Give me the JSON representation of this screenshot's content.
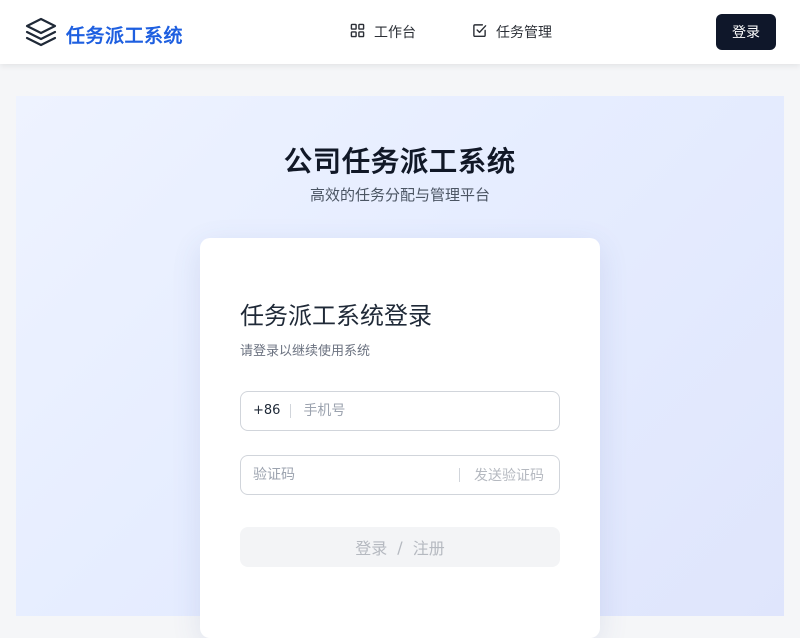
{
  "header": {
    "brand": "任务派工系统",
    "logo_icon": "layers-icon",
    "nav": [
      {
        "label": "工作台",
        "icon": "grid-icon"
      },
      {
        "label": "任务管理",
        "icon": "checkbox-icon"
      }
    ],
    "login_label": "登录"
  },
  "hero": {
    "title": "公司任务派工系统",
    "subtitle": "高效的任务分配与管理平台"
  },
  "login_card": {
    "title": "任务派工系统登录",
    "subtitle": "请登录以继续使用系统",
    "phone": {
      "prefix": "+86",
      "placeholder": "手机号",
      "value": ""
    },
    "code": {
      "placeholder": "验证码",
      "value": "",
      "send_label": "发送验证码"
    },
    "submit": {
      "login": "登录",
      "separator": "/",
      "register": "注册"
    }
  },
  "colors": {
    "brand": "#1e5fe0",
    "dark_button": "#0f172a",
    "disabled_text": "#b5b9c0"
  }
}
